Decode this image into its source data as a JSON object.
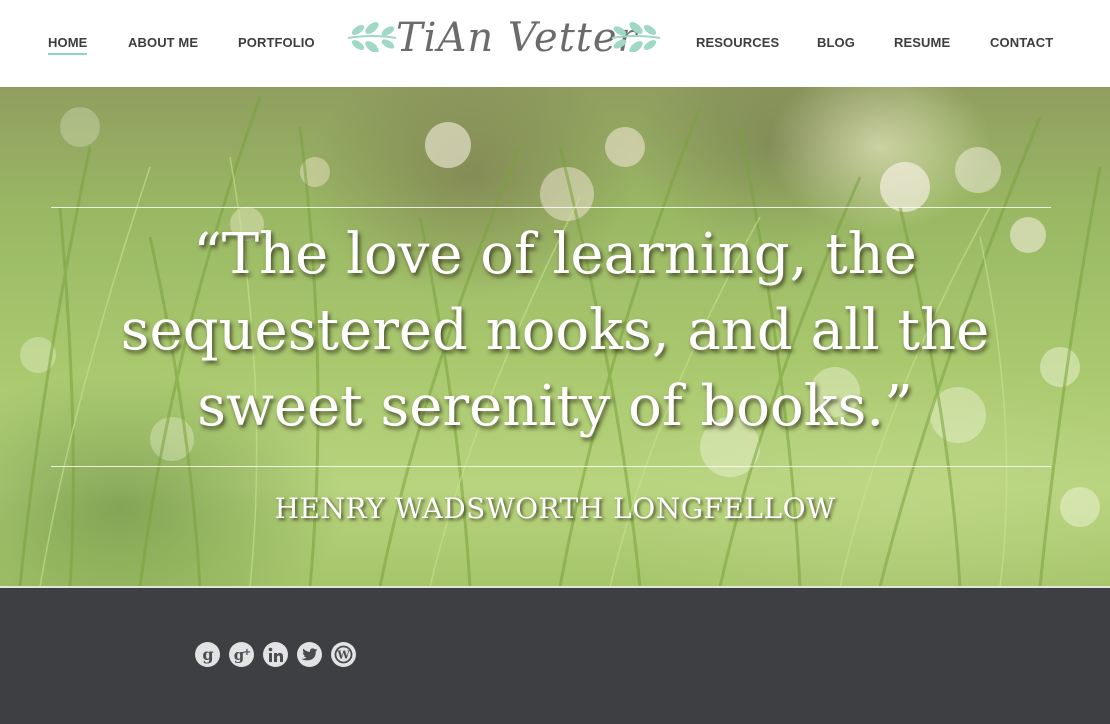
{
  "header": {
    "nav_left": [
      {
        "label": "HOME"
      },
      {
        "label": "ABOUT ME"
      },
      {
        "label": "PORTFOLIO"
      }
    ],
    "nav_right": [
      {
        "label": "RESOURCES"
      },
      {
        "label": "BLOG"
      },
      {
        "label": "RESUME"
      },
      {
        "label": "CONTACT"
      }
    ],
    "active_item": "HOME",
    "logo_text": "TiAn Vetter",
    "accent_color": "#8fd3c0"
  },
  "hero": {
    "quote": "“The love of learning, the sequestered nooks, and all the sweet serenity of books.”",
    "author": "HENRY WADSWORTH LONGFELLOW",
    "background": "sunlit grass with bokeh"
  },
  "footer": {
    "social_icons": [
      "google-icon",
      "google-plus-icon",
      "linkedin-icon",
      "twitter-icon",
      "wordpress-icon"
    ],
    "background_color": "#3d3f42"
  }
}
